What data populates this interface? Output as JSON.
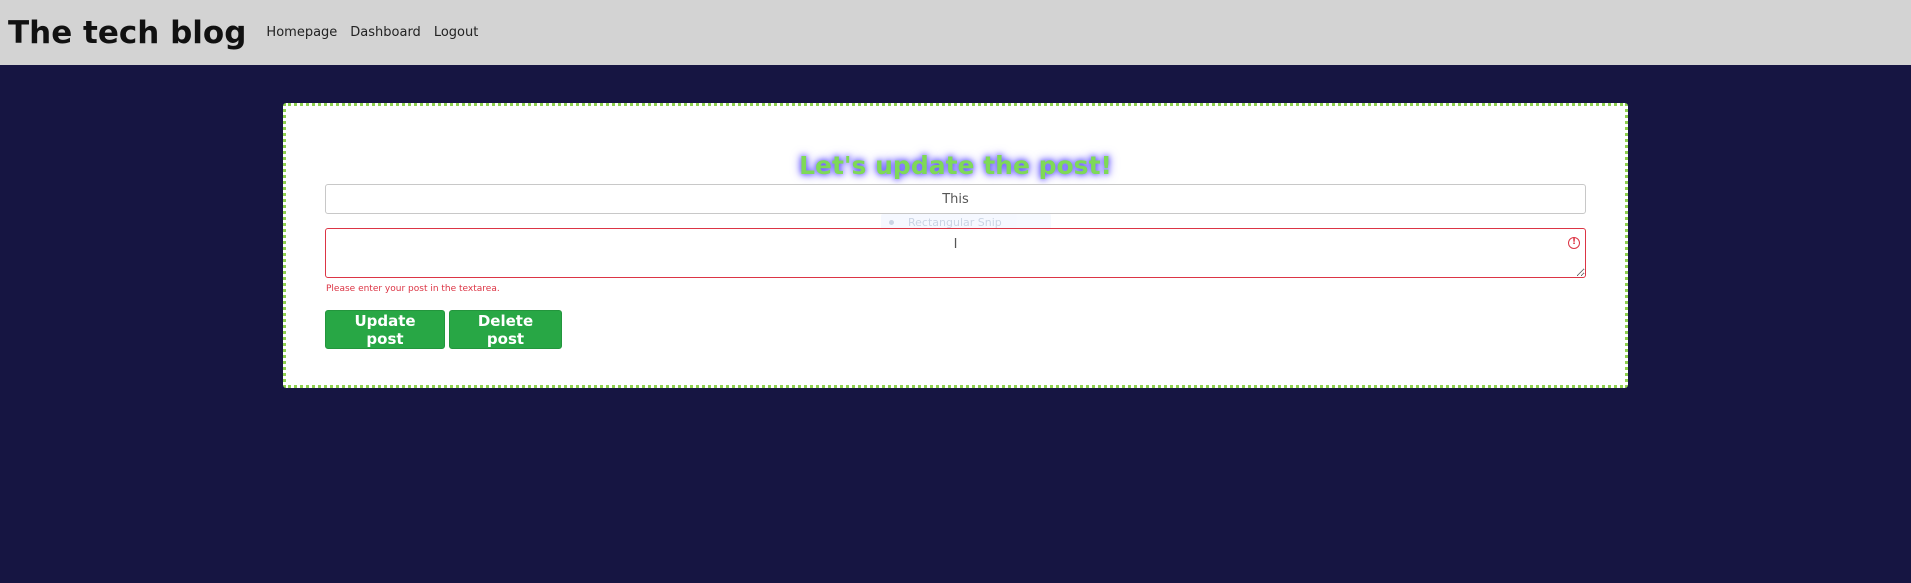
{
  "header": {
    "brand": "The tech blog",
    "nav": [
      {
        "label": "Homepage"
      },
      {
        "label": "Dashboard"
      },
      {
        "label": "Logout"
      }
    ]
  },
  "form": {
    "title": "Let's update the post!",
    "title_input_value": "This",
    "textarea_value": "I",
    "feedback": "Please enter your post in the textarea.",
    "update_label": "Update post",
    "delete_label": "Delete post",
    "ghost_label": "Rectangular Snip"
  },
  "colors": {
    "background": "#161542",
    "navbar": "#d3d3d3",
    "accent_green": "#28a745",
    "title_green": "#7ed957",
    "error_red": "#dc3545",
    "card_border": "#8fd14f"
  },
  "icons": {
    "invalid": "exclamation-circle-icon"
  }
}
